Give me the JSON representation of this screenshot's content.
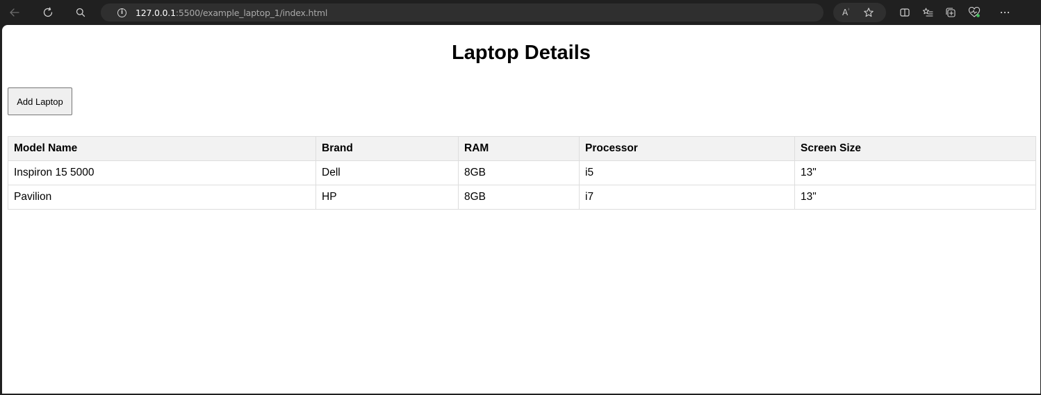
{
  "browser": {
    "url_host": "127.0.0.1",
    "url_rest": ":5500/example_laptop_1/index.html",
    "read_aloud_label": "A"
  },
  "page": {
    "title": "Laptop Details",
    "add_button_label": "Add Laptop"
  },
  "table": {
    "headers": [
      "Model Name",
      "Brand",
      "RAM",
      "Processor",
      "Screen Size"
    ],
    "rows": [
      [
        "Inspiron 15 5000",
        "Dell",
        "8GB",
        "i5",
        "13\""
      ],
      [
        "Pavilion",
        "HP",
        "8GB",
        "i7",
        "13\""
      ]
    ]
  },
  "colors": {
    "browser_chrome": "#202020",
    "address_bar": "#2f2f2f",
    "table_header_bg": "#f2f2f2",
    "table_border": "#dddddd",
    "button_bg": "#efefef"
  }
}
